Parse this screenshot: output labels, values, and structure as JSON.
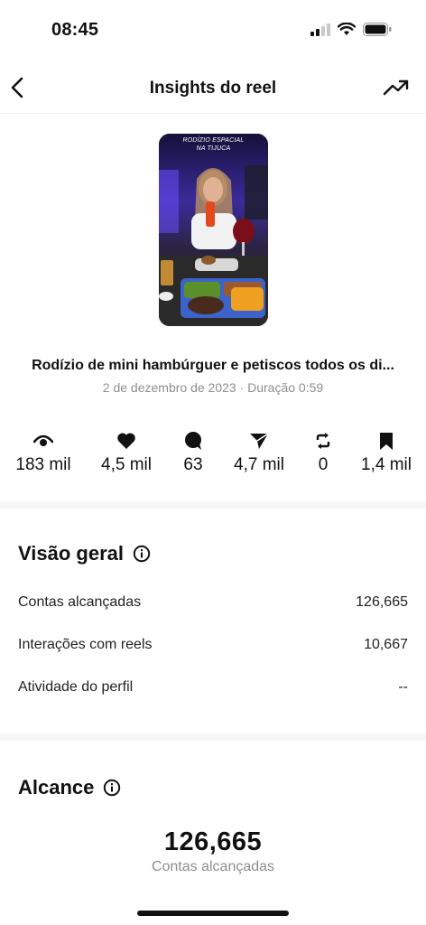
{
  "status_bar": {
    "time": "08:45"
  },
  "nav": {
    "title": "Insights do reel"
  },
  "reel": {
    "thumbnail_caption_line1": "RODÍZIO ESPACIAL",
    "thumbnail_caption_line2": "NA TIJUCA",
    "title": "Rodízio de mini hambúrguer e petiscos todos os di...",
    "meta": "2 de dezembro de 2023 · Duração 0:59"
  },
  "stats": [
    {
      "icon": "eye-icon",
      "value": "183 mil"
    },
    {
      "icon": "heart-icon",
      "value": "4,5 mil"
    },
    {
      "icon": "comment-icon",
      "value": "63"
    },
    {
      "icon": "share-icon",
      "value": "4,7 mil"
    },
    {
      "icon": "repost-icon",
      "value": "0"
    },
    {
      "icon": "bookmark-icon",
      "value": "1,4 mil"
    }
  ],
  "overview": {
    "title": "Visão geral",
    "rows": [
      {
        "label": "Contas alcançadas",
        "value": "126,665"
      },
      {
        "label": "Interações com reels",
        "value": "10,667"
      },
      {
        "label": "Atividade do perfil",
        "value": "--"
      }
    ]
  },
  "reach": {
    "title": "Alcance",
    "value": "126,665",
    "label": "Contas alcançadas"
  }
}
